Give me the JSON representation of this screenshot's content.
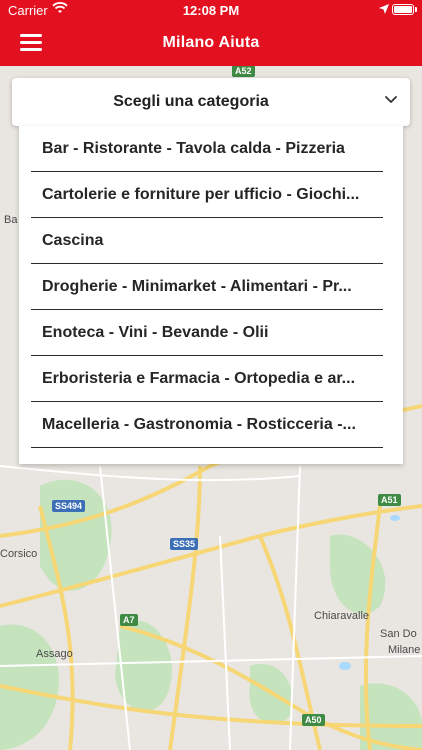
{
  "status_bar": {
    "carrier": "Carrier",
    "time": "12:08 PM"
  },
  "nav": {
    "title": "Milano Aiuta"
  },
  "category_select": {
    "label": "Scegli una categoria",
    "options": [
      "Bar - Ristorante - Tavola calda - Pizzeria",
      "Cartolerie e forniture per ufficio - Giochi...",
      "Cascina",
      "Drogherie - Minimarket - Alimentari - Pr...",
      "Enoteca - Vini - Bevande - Olii",
      "Erboristeria e Farmacia - Ortopedia e ar...",
      "Macelleria - Gastronomia - Rosticceria -..."
    ]
  },
  "map": {
    "labels": {
      "corsico": "Corsico",
      "assago": "Assago",
      "chiaravalle": "Chiaravalle",
      "san_donato": "San Do",
      "milanese": "Milane",
      "ba": "Ba"
    },
    "road_shields": {
      "a52": "A52",
      "ss494": "SS494",
      "ss35": "SS35",
      "a51": "A51",
      "a7": "A7",
      "a50": "A50"
    }
  },
  "colors": {
    "brand_red": "#e3101f",
    "map_bg": "#e9e6e1",
    "park_green": "#c5e4bd",
    "road_yellow": "#f6d675"
  }
}
